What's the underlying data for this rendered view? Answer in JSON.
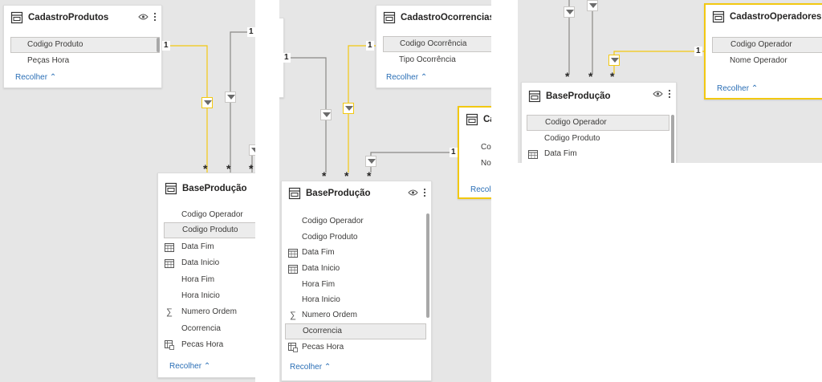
{
  "panel1": {
    "top_table": {
      "title": "CadastroProdutos",
      "fields": [
        "Codigo Produto",
        "Peças Hora"
      ],
      "collapse": "Recolher"
    },
    "base_table": {
      "title": "BaseProdução",
      "fields": [
        "Codigo Operador",
        "Codigo Produto",
        "Data Fim",
        "Data Inicio",
        "Hora Fim",
        "Hora Inicio",
        "Numero Ordem",
        "Ocorrencia",
        "Pecas Hora"
      ],
      "collapse": "Recolher"
    },
    "one": "1",
    "many": "*"
  },
  "panel2": {
    "top_table": {
      "title": "CadastroOcorrencias",
      "fields": [
        "Codigo Ocorrência",
        "Tipo Ocorrência"
      ],
      "collapse": "Recolher"
    },
    "side_table": {
      "title_visible": "Ca",
      "fields_visible": [
        "Co",
        "No"
      ],
      "collapse_visible": "Recolh"
    },
    "base_table": {
      "title": "BaseProdução",
      "fields": [
        "Codigo Operador",
        "Codigo Produto",
        "Data Fim",
        "Data Inicio",
        "Hora Fim",
        "Hora Inicio",
        "Numero Ordem",
        "Ocorrencia",
        "Pecas Hora"
      ],
      "collapse": "Recolher"
    },
    "one": "1",
    "many": "*"
  },
  "panel3": {
    "top_table": {
      "title": "CadastroOperadores",
      "fields": [
        "Codigo Operador",
        "Nome Operador"
      ],
      "collapse": "Recolher"
    },
    "base_table": {
      "title": "BaseProdução",
      "fields": [
        "Codigo Operador",
        "Codigo Produto",
        "Data Fim"
      ]
    },
    "one": "1",
    "many": "*"
  },
  "colors": {
    "relationship_active": "#f2c811",
    "relationship_inactive": "#8a8886",
    "canvas": "#e6e6e6",
    "link": "#2b6fb6"
  },
  "icons": [
    "table-icon",
    "eye-icon",
    "more-options-icon",
    "calendar-icon",
    "sigma-icon",
    "calculated-table-icon",
    "chevron-up-icon",
    "filter-direction-arrow-icon"
  ]
}
